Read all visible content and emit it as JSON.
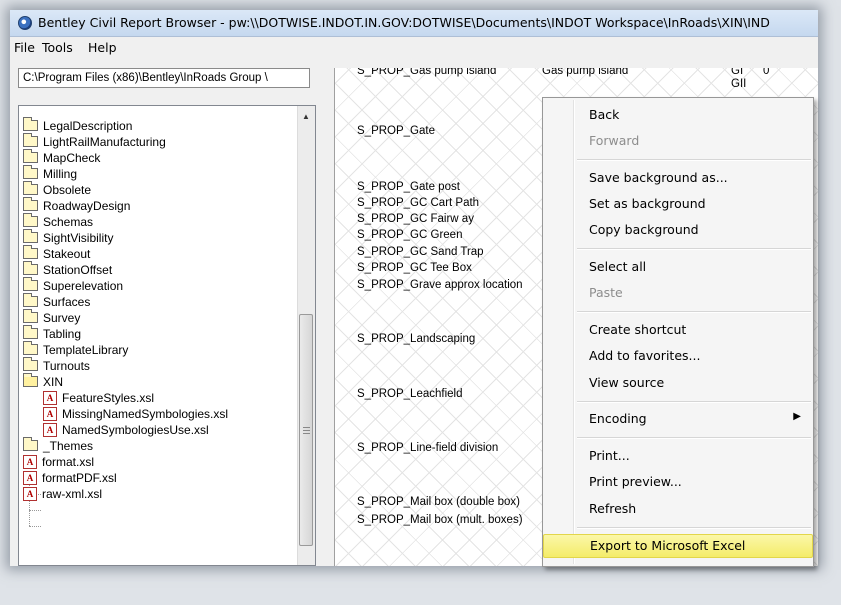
{
  "window": {
    "title": "Bentley Civil Report Browser - pw:\\\\DOTWISE.INDOT.IN.GOV:DOTWISE\\Documents\\INDOT Workspace\\InRoads\\XIN\\IND"
  },
  "menubar": {
    "file": "File",
    "tools": "Tools",
    "help": "Help"
  },
  "left": {
    "path": "C:\\Program Files (x86)\\Bentley\\InRoads Group \\",
    "tree": [
      {
        "label": "LegalDescription"
      },
      {
        "label": "LightRailManufacturing"
      },
      {
        "label": "MapCheck"
      },
      {
        "label": "Milling"
      },
      {
        "label": "Obsolete"
      },
      {
        "label": "RoadwayDesign"
      },
      {
        "label": "Schemas"
      },
      {
        "label": "SightVisibility"
      },
      {
        "label": "Stakeout"
      },
      {
        "label": "StationOffset"
      },
      {
        "label": "Superelevation"
      },
      {
        "label": "Surfaces"
      },
      {
        "label": "Survey"
      },
      {
        "label": "Tabling"
      },
      {
        "label": "TemplateLibrary"
      },
      {
        "label": "Turnouts"
      },
      {
        "label": "XIN"
      },
      {
        "label": "FeatureStyles.xsl"
      },
      {
        "label": "MissingNamedSymbologies.xsl"
      },
      {
        "label": "NamedSymbologiesUse.xsl"
      },
      {
        "label": "_Themes"
      },
      {
        "label": "format.xsl"
      },
      {
        "label": "formatPDF.xsl"
      },
      {
        "label": "raw-xml.xsl"
      }
    ]
  },
  "report": {
    "header": [
      "S_PROP_Gas pump island",
      "Gas pump island",
      "GI",
      "0",
      "GII"
    ],
    "rows": [
      "S_PROP_Gate",
      "S_PROP_Gate post",
      "S_PROP_GC Cart Path",
      "S_PROP_GC Fairw ay",
      "S_PROP_GC Green",
      "S_PROP_GC Sand Trap",
      "S_PROP_GC Tee Box",
      "S_PROP_Grave approx location",
      "S_PROP_Landscaping",
      "S_PROP_Leachfield",
      "S_PROP_Line-field division",
      "S_PROP_Mail box (double box)",
      "S_PROP_Mail box (mult. boxes)"
    ]
  },
  "context_menu": {
    "items": [
      {
        "label": "Back"
      },
      {
        "label": "Forward"
      },
      {
        "label": "Save background as..."
      },
      {
        "label": "Set as background"
      },
      {
        "label": "Copy background"
      },
      {
        "label": "Select all"
      },
      {
        "label": "Paste"
      },
      {
        "label": "Create shortcut"
      },
      {
        "label": "Add to favorites..."
      },
      {
        "label": "View source"
      },
      {
        "label": "Encoding"
      },
      {
        "label": "Print..."
      },
      {
        "label": "Print preview..."
      },
      {
        "label": "Refresh"
      },
      {
        "label": "Export to Microsoft Excel"
      }
    ],
    "highlight_color": "#f4ec6a"
  }
}
